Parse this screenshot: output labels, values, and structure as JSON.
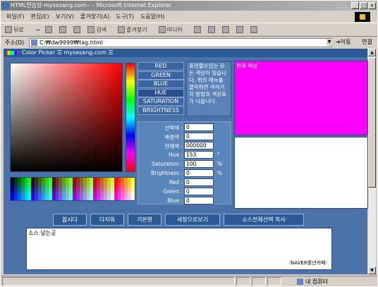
{
  "window": {
    "title": "HTML연습장-mysesang.com-- - Microsoft Internet Explorer",
    "controls": [
      "_",
      "□",
      "×"
    ]
  },
  "menu": [
    "파일(F)",
    "편집(E)",
    "보기(V)",
    "즐겨찾기(A)",
    "도구(T)",
    "도움말(H)"
  ],
  "toolbar": {
    "back": "뒤로",
    "forward": "→",
    "search": "검색",
    "favorites": "즐겨찾기",
    "media": "미디어"
  },
  "address": {
    "label": "주소(D)",
    "url": "C:₩dw9999₩tag.html",
    "go": "이동",
    "links": "연결"
  },
  "picker": {
    "title": "Color Picker ☰ mysesang.com ☰",
    "modes": [
      "RED",
      "GREEN",
      "BLUE",
      "HUE",
      "SATURATION",
      "BRIGHTNESS"
    ],
    "note": "표현할수있는 모든 색상이 있습니다. 위의 메뉴를 클릭하면 여러가지 방법의 색상표가 나옵니다.",
    "fields": [
      {
        "label": "선택색 :",
        "value": "0",
        "unit": ""
      },
      {
        "label": "배경색 :",
        "value": "0",
        "unit": ""
      },
      {
        "label": "현재색 :",
        "value": "000000",
        "unit": ""
      },
      {
        "label": "Hue :",
        "value": "153",
        "unit": "°"
      },
      {
        "label": "Saturation :",
        "value": "100",
        "unit": "%"
      },
      {
        "label": "Brightness :",
        "value": "0",
        "unit": "%"
      },
      {
        "label": "Red :",
        "value": "0",
        "unit": ""
      },
      {
        "label": "Green :",
        "value": "0",
        "unit": ""
      },
      {
        "label": "Blue :",
        "value": "0",
        "unit": ""
      }
    ],
    "current_label": "현재 색상",
    "current_color": "#ff00ff",
    "actions": [
      "봅시다",
      "다지워",
      "기본형",
      "새창으로보기",
      "소스전체선택 복사"
    ],
    "source_placeholder": "소스 넣는곳",
    "credit": "-NAVER중년카페-"
  },
  "status": {
    "zone": "내 컴퓨터"
  }
}
